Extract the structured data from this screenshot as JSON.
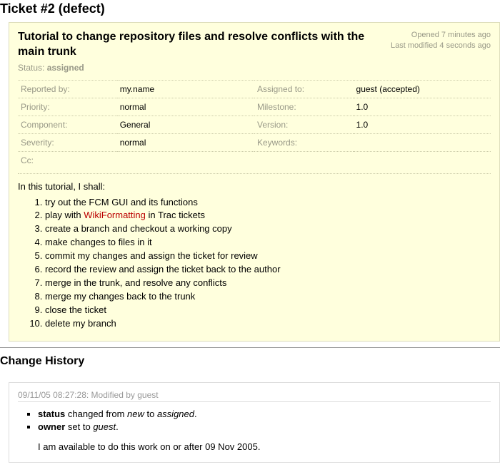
{
  "header": {
    "title": "Ticket #2 (defect)"
  },
  "ticket": {
    "summary": "Tutorial to change repository files and resolve conflicts with the main trunk",
    "opened": "Opened 7 minutes ago",
    "modified": "Last modified 4 seconds ago",
    "status_label": "Status:",
    "status_value": "assigned",
    "props": {
      "reported_by_label": "Reported by:",
      "reported_by_value": "my.name",
      "assigned_to_label": "Assigned to:",
      "assigned_to_value": "guest (accepted)",
      "priority_label": "Priority:",
      "priority_value": "normal",
      "milestone_label": "Milestone:",
      "milestone_value": "1.0",
      "component_label": "Component:",
      "component_value": "General",
      "version_label": "Version:",
      "version_value": "1.0",
      "severity_label": "Severity:",
      "severity_value": "normal",
      "keywords_label": "Keywords:",
      "keywords_value": "",
      "cc_label": "Cc:",
      "cc_value": ""
    },
    "description": {
      "intro": "In this tutorial, I shall:",
      "items": [
        "try out the FCM GUI and its functions",
        "play with ",
        " in Trac tickets",
        "create a branch and checkout a working copy",
        "make changes to files in it",
        "commit my changes and assign the ticket for review",
        "record the review and assign the ticket back to the author",
        "merge in the trunk, and resolve any conflicts",
        "merge my changes back to the trunk",
        "close the ticket",
        "delete my branch"
      ],
      "wiki_link_text": "WikiFormatting"
    }
  },
  "change_history": {
    "heading": "Change History",
    "entry": {
      "header": "09/11/05 08:27:28: Modified by guest",
      "status_field": "status",
      "status_changed": " changed from ",
      "status_old": "new",
      "status_to": " to ",
      "status_new": "assigned",
      "owner_field": "owner",
      "owner_set": " set to ",
      "owner_value": "guest",
      "period": ".",
      "comment": "I am available to do this work on or after 09 Nov 2005."
    }
  }
}
